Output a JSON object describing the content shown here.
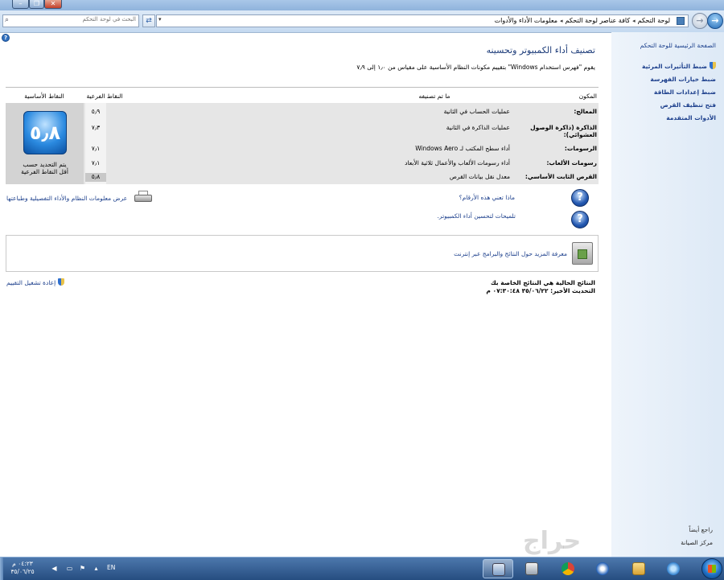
{
  "window": {
    "close_glyph": "✕",
    "restore_glyph": "❐",
    "minimize_glyph": "–"
  },
  "toolbar": {
    "search_placeholder": "البحث في لوحة التحكم",
    "breadcrumbs": [
      "لوحة التحكم",
      "كافة عناصر لوحة التحكم",
      "معلومات الأداء والأدوات"
    ],
    "breadcrumb_separator": "◂"
  },
  "sidebar": {
    "home_link": "الصفحة الرئيسية للوحة التحكم",
    "links": [
      "ضبط التأثيرات المرئية",
      "ضبط خيارات الفهرسة",
      "ضبط إعدادات الطاقة",
      "فتح تنظيف القرص",
      "الأدوات المتقدمة"
    ],
    "see_also_title": "راجع أيضاً",
    "see_also_links": [
      "مركز الصيانة"
    ]
  },
  "main": {
    "title": "تصنيف أداء الكمبيوتر وتحسينه",
    "description": "يقوم \"فهرس استخدام Windows\" بتقييم مكونات النظام الأساسية على مقياس من ١٫٠ إلى ٧٫٩",
    "table": {
      "headers": {
        "component": "المكون",
        "rated": "ما تم تصنيفه",
        "subscore": "النقاط الفرعية",
        "basescore": "النقاط الأساسية"
      },
      "rows": [
        {
          "component": "المعالج:",
          "rated": "عمليات الحساب في الثانية",
          "subscore": "٥٫٩"
        },
        {
          "component": "الذاكرة (ذاكرة الوصول العشوائي):",
          "rated": "عمليات الذاكرة في الثانية",
          "subscore": "٧٫٣"
        },
        {
          "component": "الرسومات:",
          "rated": "أداء سطح المكتب لـ Windows Aero",
          "subscore": "٧٫١"
        },
        {
          "component": "رسومات الألعاب:",
          "rated": "أداء رسومات الألعاب والأعمال ثلاثية الأبعاد",
          "subscore": "٧٫١"
        },
        {
          "component": "القرص الثابت الأساسي:",
          "rated": "معدل نقل بيانات القرص",
          "subscore": "٥٫٨"
        }
      ],
      "base_score": "٥٫٨",
      "base_caption_line1": "يتم التحديد حسب",
      "base_caption_line2": "أقل النقاط الفرعية"
    },
    "help_links": {
      "what_numbers": "ماذا تعني هذه الأرقام؟",
      "tips": "تلميحات لتحسين أداء الكمبيوتر.",
      "print_details": "عرض معلومات النظام والأداء التفصيلية وطباعتها"
    },
    "more_online": "معرفة المزيد حول النتائج والبرامج عبر إنترنت",
    "results_note_line1": "النتائج الحالية هي النتائج الخاصة بك",
    "results_note_line2": "التحديث الأخير: ٣٥/٠٦/٢٢ ٠٧:٣٠:٤٨ م",
    "rerun": "إعادة تشغيل التقييم"
  },
  "taskbar": {
    "clock_time": "٠٤:٢٣ م",
    "clock_date": "٣٥/٠٦/٢٥",
    "language": "EN"
  },
  "watermark": "حراج",
  "colors": {
    "link": "#1c3f8c",
    "title": "#1e3d7a",
    "sidebar_bg": "#e5eef8",
    "taskbar": "#2f5a91"
  },
  "icons": {
    "search": "search-icon",
    "help": "help-icon",
    "question": "question-icon",
    "printer": "printer-icon",
    "shield": "shield-icon"
  }
}
